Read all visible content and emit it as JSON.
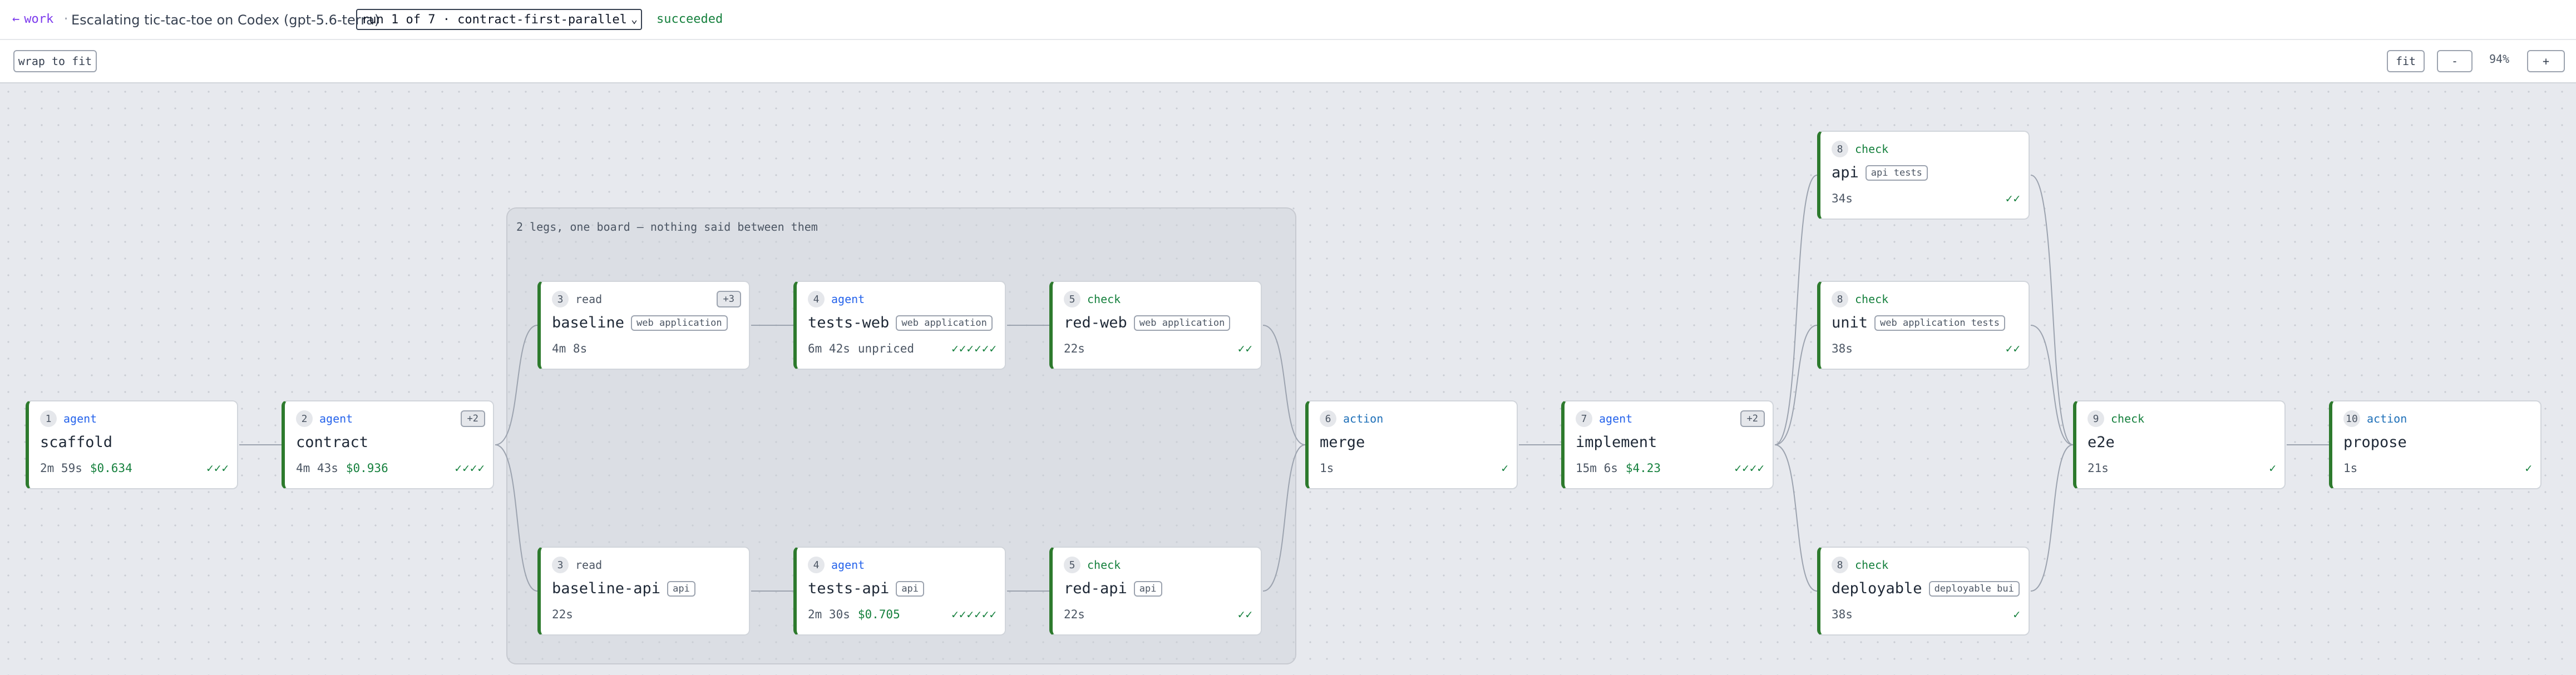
{
  "header": {
    "back_label": "work",
    "back_icon": "←",
    "separator": "·",
    "title": "Escalating tic-tac-toe on Codex (gpt-5.6-terra)",
    "run_select": "run 1 of 7 · contract-first-parallel",
    "status": "succeeded"
  },
  "toolbar": {
    "wrap_label": "wrap to fit",
    "fit_label": "fit",
    "zoom_out_label": "-",
    "zoom_level": "94%",
    "zoom_in_label": "+"
  },
  "group": {
    "label": "2 legs, one board — nothing said between them"
  },
  "nodes": {
    "scaffold": {
      "num": "1",
      "kind": "agent",
      "name": "scaffold",
      "time": "2m 59s",
      "cost": "$0.634",
      "checks": "✓✓✓"
    },
    "contract": {
      "num": "2",
      "kind": "agent",
      "name": "contract",
      "more": "+2",
      "time": "4m 43s",
      "cost": "$0.936",
      "checks": "✓✓✓✓"
    },
    "baseline": {
      "num": "3",
      "kind": "read",
      "name": "baseline",
      "tag": "web application",
      "more": "+3",
      "time": "4m 8s"
    },
    "tests_web": {
      "num": "4",
      "kind": "agent",
      "name": "tests-web",
      "tag": "web application",
      "time": "6m 42s",
      "extra": "unpriced",
      "checks": "✓✓✓✓✓✓"
    },
    "red_web": {
      "num": "5",
      "kind": "check",
      "name": "red-web",
      "tag": "web application",
      "time": "22s",
      "checks": "✓✓"
    },
    "baseline_api": {
      "num": "3",
      "kind": "read",
      "name": "baseline-api",
      "tag": "api",
      "time": "22s"
    },
    "tests_api": {
      "num": "4",
      "kind": "agent",
      "name": "tests-api",
      "tag": "api",
      "time": "2m 30s",
      "cost": "$0.705",
      "checks": "✓✓✓✓✓✓"
    },
    "red_api": {
      "num": "5",
      "kind": "check",
      "name": "red-api",
      "tag": "api",
      "time": "22s",
      "checks": "✓✓"
    },
    "merge": {
      "num": "6",
      "kind": "action",
      "name": "merge",
      "time": "1s",
      "checks": "✓"
    },
    "implement": {
      "num": "7",
      "kind": "agent",
      "name": "implement",
      "more": "+2",
      "time": "15m 6s",
      "cost": "$4.23",
      "checks": "✓✓✓✓"
    },
    "api": {
      "num": "8",
      "kind": "check",
      "name": "api",
      "tag": "api tests",
      "time": "34s",
      "checks": "✓✓"
    },
    "unit": {
      "num": "8",
      "kind": "check",
      "name": "unit",
      "tag": "web application tests",
      "time": "38s",
      "checks": "✓✓"
    },
    "deployable": {
      "num": "8",
      "kind": "check",
      "name": "deployable",
      "tag": "deployable bui",
      "time": "38s",
      "checks": "✓"
    },
    "e2e": {
      "num": "9",
      "kind": "check",
      "name": "e2e",
      "time": "21s",
      "checks": "✓"
    },
    "propose": {
      "num": "10",
      "kind": "action",
      "name": "propose",
      "time": "1s",
      "checks": "✓"
    }
  },
  "colors": {
    "accent_green": "#2d7a2d",
    "agent_blue": "#2563eb",
    "check_green": "#15803d",
    "back_purple": "#7c3aed"
  }
}
